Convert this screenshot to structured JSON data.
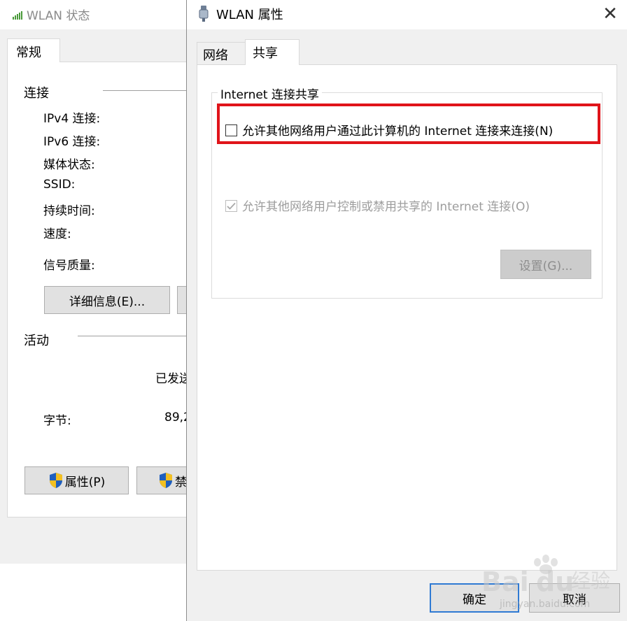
{
  "status_window": {
    "title": "WLAN 状态",
    "tab_general": "常规",
    "connection_section": "连接",
    "rows": {
      "ipv4": "IPv4 连接:",
      "ipv6": "IPv6 连接:",
      "media": "媒体状态:",
      "ssid": "SSID:",
      "duration": "持续时间:",
      "speed": "速度:",
      "signal": "信号质量:"
    },
    "details_button": "详细信息(E)...",
    "activity_section": "活动",
    "sent_label_partial": "已发送",
    "bytes_label": "字节:",
    "bytes_sent_partial": "89,2",
    "properties_button": "属性(P)",
    "disable_button_partial": "禁"
  },
  "props_window": {
    "title": "WLAN 属性",
    "tabs": [
      {
        "label": "网络",
        "active": false
      },
      {
        "label": "共享",
        "active": true
      }
    ],
    "ics_group_title": "Internet 连接共享",
    "allow_sharing_label": "允许其他网络用户通过此计算机的 Internet 连接来连接(N)",
    "allow_sharing_checked": false,
    "allow_control_label": "允许其他网络用户控制或禁用共享的 Internet 连接(O)",
    "allow_control_checked": true,
    "allow_control_enabled": false,
    "settings_button": "设置(G)...",
    "ok_button": "确定",
    "cancel_button": "取消"
  },
  "watermark": {
    "brand": "Bai",
    "brand2": "du",
    "suffix": "经验",
    "url": "jingyan.baidu.com"
  },
  "colors": {
    "highlight": "#e0141a",
    "ok_border": "#2f7ad3",
    "disabled_text": "#9d9d9d"
  },
  "icons": [
    "signal-icon",
    "network-adapter-icon",
    "close-icon",
    "shield-icon",
    "check-icon"
  ]
}
